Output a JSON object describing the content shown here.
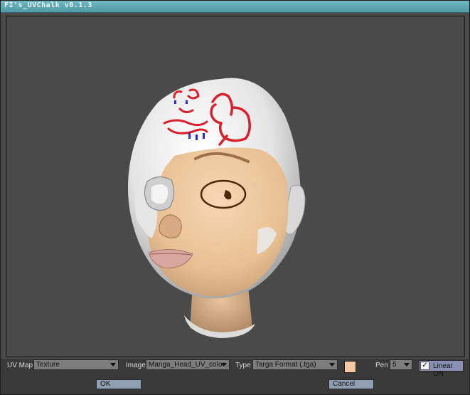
{
  "window": {
    "title": "FI's_UVChalk v0.1.3"
  },
  "toolbar": {
    "uvmap_label": "UV Map",
    "uvmap_value": "Texture",
    "image_label": "Image",
    "image_value": "Manga_Head_UV_color ...",
    "type_label": "Type",
    "type_value": "Targa Format (.tga)",
    "swatch_color": "#f2c9a0",
    "pen_label": "Pen",
    "pen_value": "5",
    "linear_label": "Linear ON",
    "linear_checked": true,
    "linear_check_glyph": "✓"
  },
  "buttons": {
    "ok_label": "OK",
    "cancel_label": "Cancel"
  },
  "icons": [
    "chevron-down-icon",
    "checkmark-icon"
  ]
}
